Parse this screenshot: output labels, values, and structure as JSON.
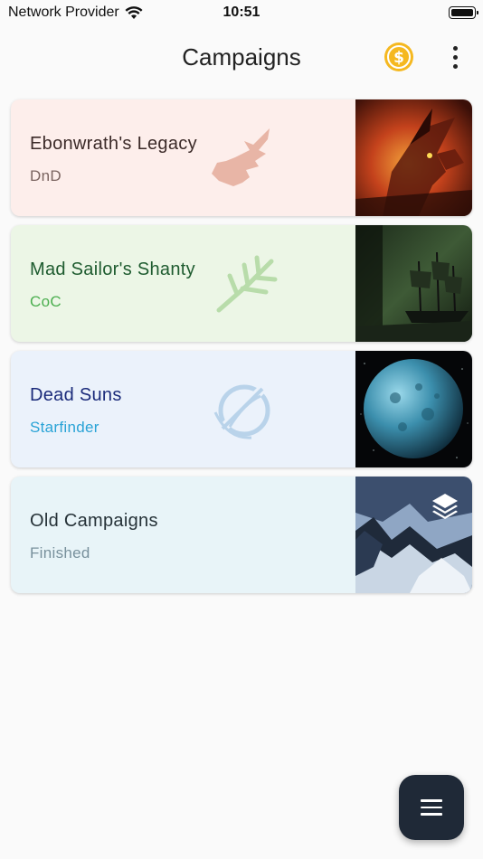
{
  "status_bar": {
    "carrier": "Network Provider",
    "time": "10:51"
  },
  "app_bar": {
    "title": "Campaigns",
    "coin_icon": "dollar-coin-icon",
    "more_icon": "more-vert-icon"
  },
  "campaigns": [
    {
      "title": "Ebonwrath's Legacy",
      "subtitle": "DnD",
      "emblem": "dragon-head-icon",
      "image": "red-dragon-artwork",
      "colors": {
        "bg": "#fdeeeb",
        "title": "#3b2a28",
        "subtitle": "#7a6460",
        "emblem": "#e8b5a6"
      }
    },
    {
      "title": "Mad Sailor's Shanty",
      "subtitle": "CoC",
      "emblem": "tentacle-branch-icon",
      "image": "ghost-ship-artwork",
      "colors": {
        "bg": "#ecf6e6",
        "title": "#1e5b2f",
        "subtitle": "#4caf50",
        "emblem": "#b8dcaa"
      }
    },
    {
      "title": "Dead Suns",
      "subtitle": "Starfinder",
      "emblem": "planet-ring-icon",
      "image": "blue-planet-artwork",
      "colors": {
        "bg": "#ebf2fb",
        "title": "#1a2a7a",
        "subtitle": "#29a3d6",
        "emblem": "#b9d3ea"
      }
    },
    {
      "title": "Old Campaigns",
      "subtitle": "Finished",
      "emblem": "",
      "image": "mountain-landscape-artwork",
      "overlay_icon": "layers-icon",
      "colors": {
        "bg": "#e8f4f8",
        "title": "#263238",
        "subtitle": "#78909c",
        "emblem": ""
      }
    }
  ],
  "fab": {
    "icon": "menu-icon"
  }
}
